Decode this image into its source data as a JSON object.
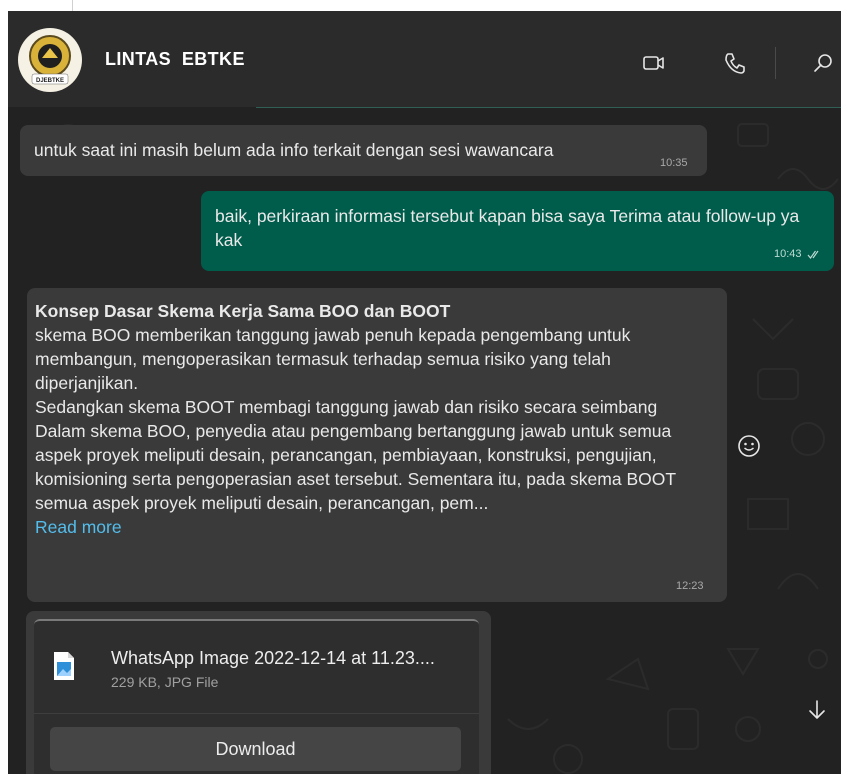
{
  "header": {
    "group_name": "LINTAS  EBTKE",
    "avatar_label": "DJEBTKE",
    "video_call_icon": "video-camera-icon",
    "voice_call_icon": "phone-icon",
    "search_icon": "search-icon"
  },
  "messages": [
    {
      "direction": "incoming",
      "text": "untuk saat ini masih belum ada info terkait dengan sesi wawancara",
      "time": "10:35"
    },
    {
      "direction": "outgoing",
      "text": "baik, perkiraan informasi tersebut kapan bisa saya Terima atau follow-up ya kak",
      "time": "10:43",
      "status_icon": "double-check-icon"
    },
    {
      "direction": "incoming",
      "title": "Konsep Dasar Skema Kerja Sama BOO dan BOOT",
      "paragraphs": [
        "skema BOO memberikan tanggung jawab penuh kepada pengembang untuk membangun, mengoperasikan termasuk terhadap semua risiko yang telah diperjanjikan.",
        "Sedangkan skema BOOT membagi tanggung jawab dan risiko secara seimbang",
        "Dalam skema BOO, penyedia atau pengembang bertanggung jawab untuk semua aspek proyek meliputi desain, perancangan, pembiayaan, konstruksi, pengujian, komisioning serta pengoperasian aset tersebut. Sementara itu, pada skema BOOT semua aspek proyek meliputi desain, perancangan, pem..."
      ],
      "read_more": "Read more",
      "time": "12:23"
    }
  ],
  "file_message": {
    "file_name": "WhatsApp Image 2022-12-14 at 11.23....",
    "file_meta": "229 KB, JPG File",
    "download_label": "Download"
  },
  "colors": {
    "chat_bg": "#222222",
    "incoming_bubble": "#3a3a3a",
    "outgoing_bubble": "#005c4b",
    "link": "#53bdeb"
  }
}
